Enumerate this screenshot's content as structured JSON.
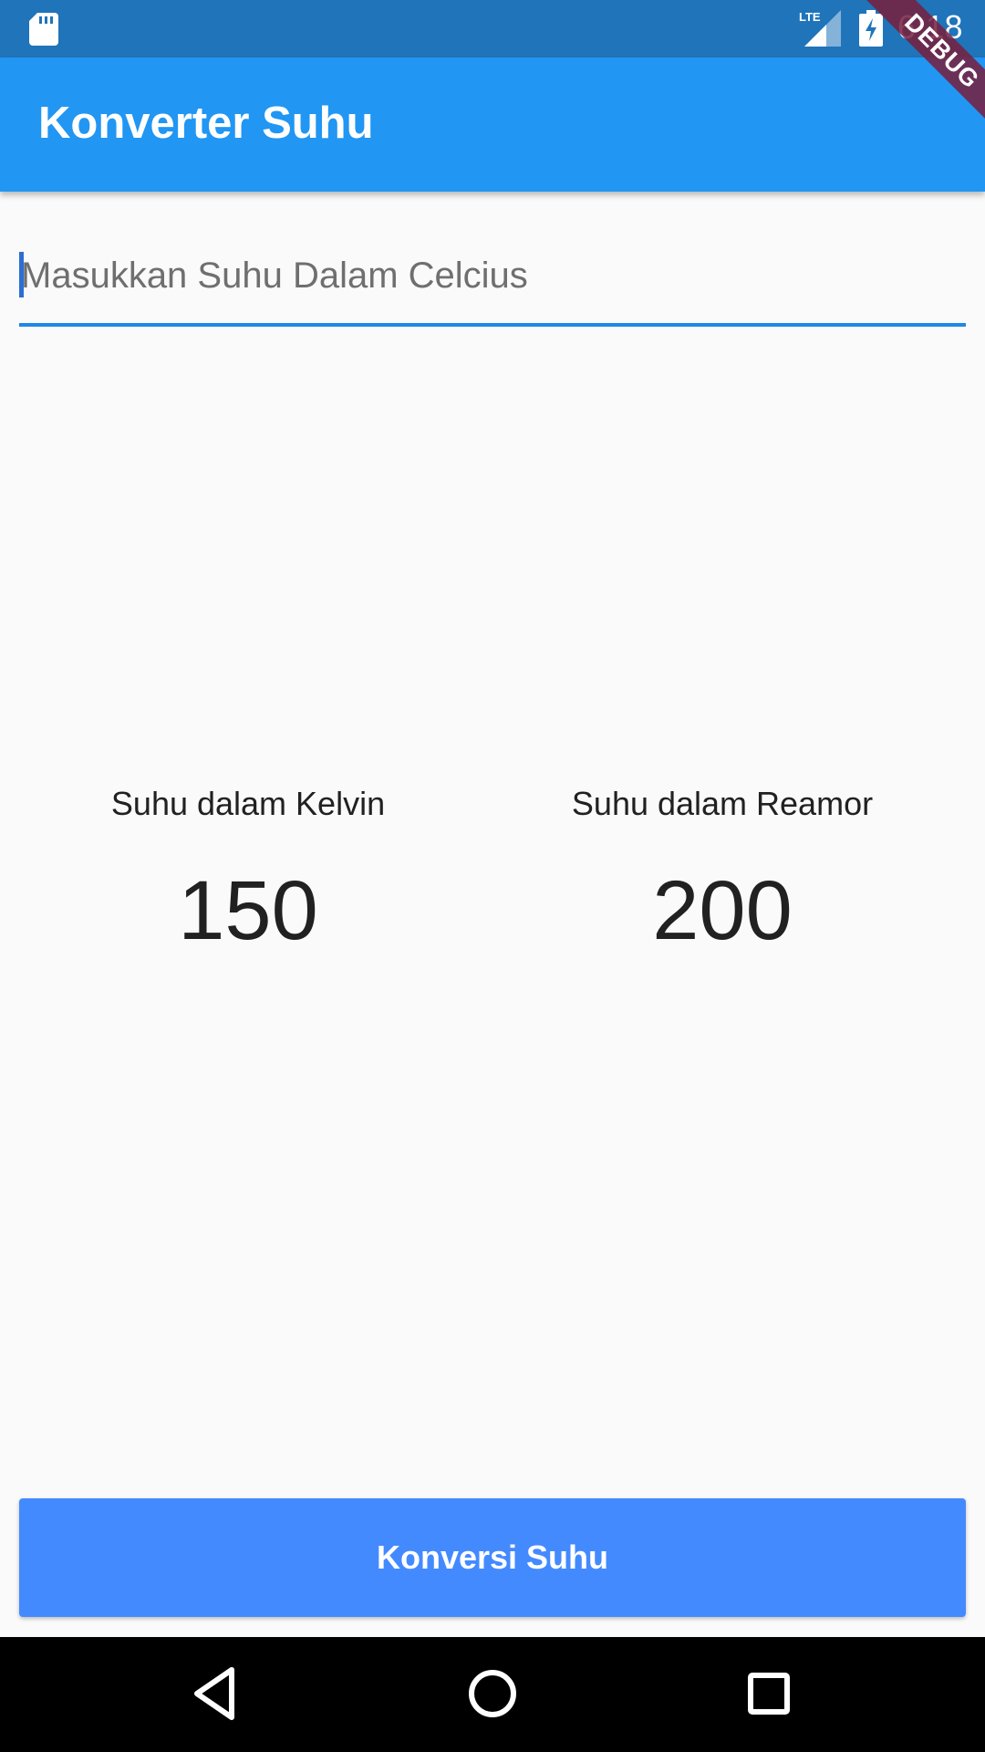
{
  "status_bar": {
    "time": "6:18",
    "network_label": "LTE",
    "icons": [
      "sd-card-icon",
      "lte-signal-icon",
      "battery-charging-icon"
    ]
  },
  "debug_banner": {
    "label": "DEBUG"
  },
  "app_bar": {
    "title": "Konverter Suhu",
    "color": "#2196f3"
  },
  "input": {
    "value": "",
    "placeholder": "Masukkan Suhu Dalam Celcius"
  },
  "results": {
    "kelvin": {
      "label": "Suhu dalam Kelvin",
      "value": "150"
    },
    "reamor": {
      "label": "Suhu dalam Reamor",
      "value": "200"
    }
  },
  "button": {
    "label": "Konversi Suhu",
    "color": "#448aff"
  },
  "nav_bar": {
    "icons": [
      "back-icon",
      "home-icon",
      "recents-icon"
    ]
  }
}
